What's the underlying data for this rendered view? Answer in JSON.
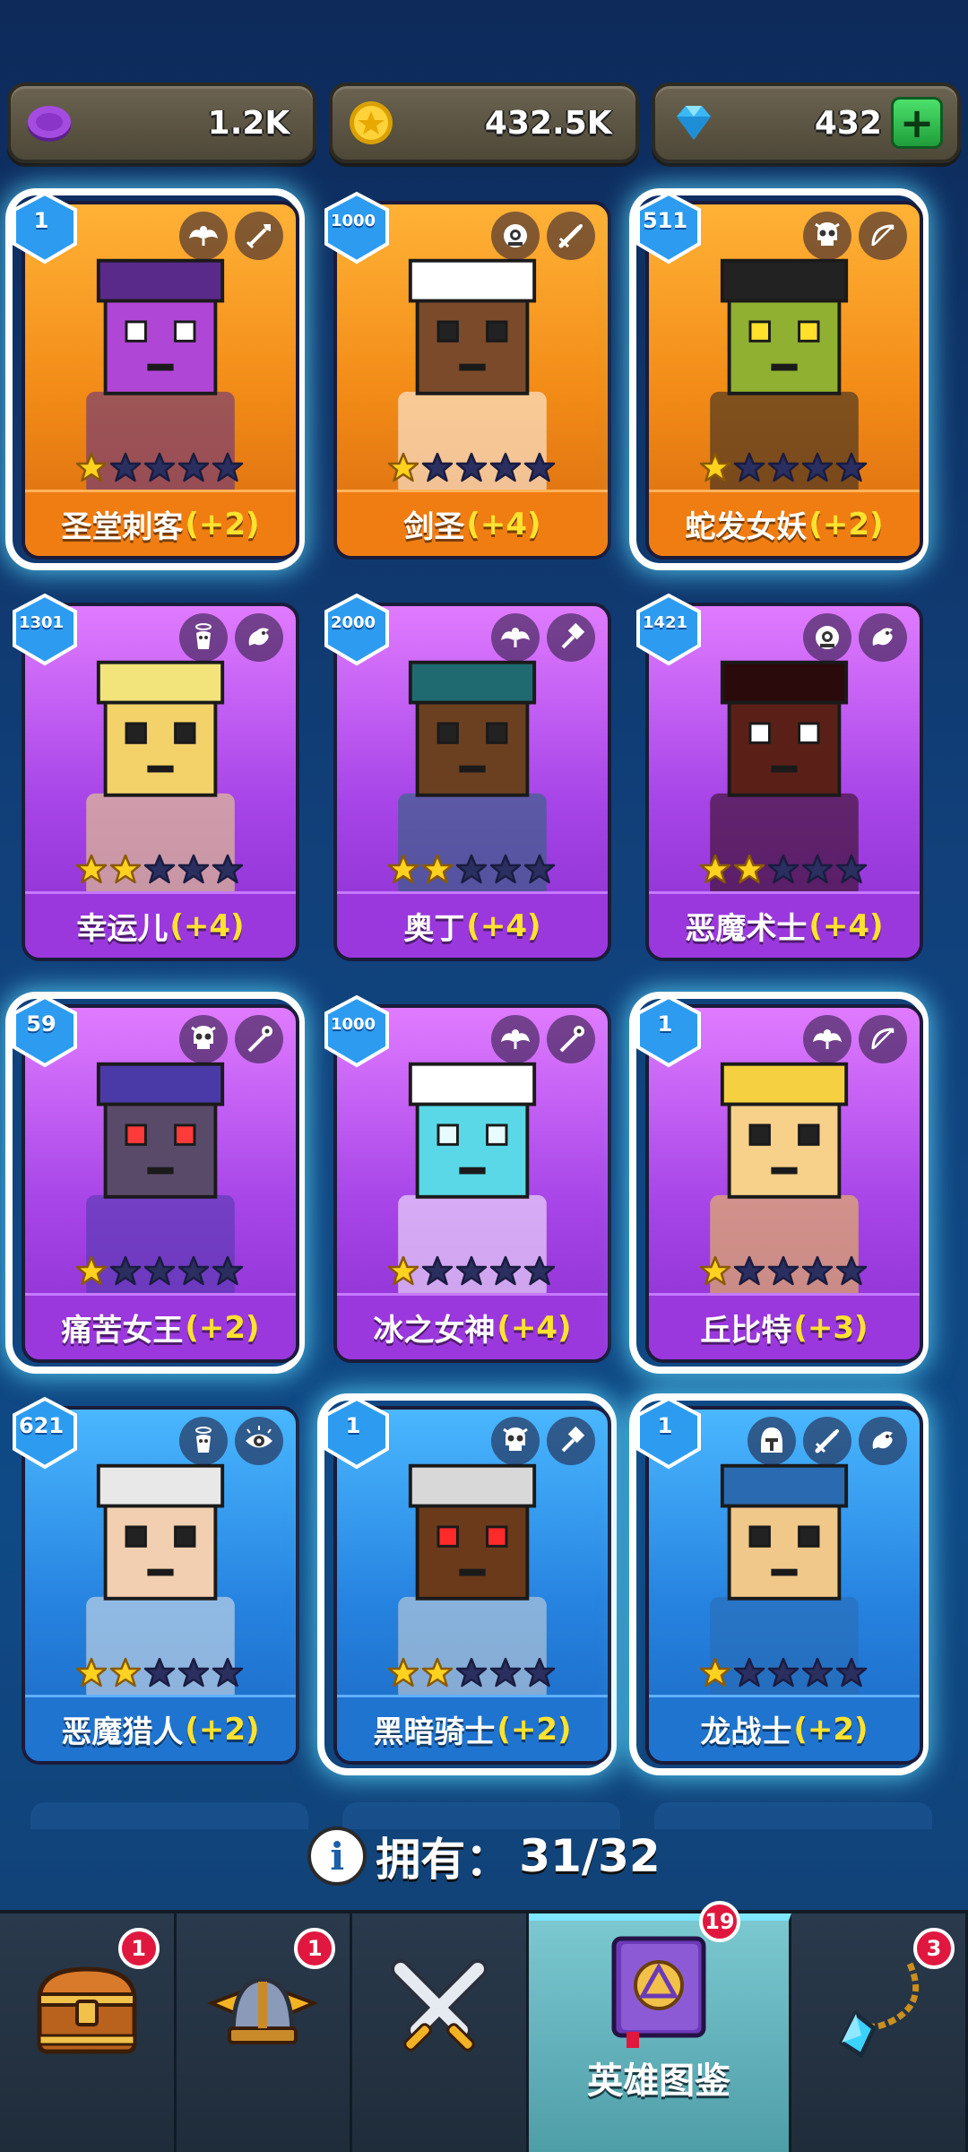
{
  "resources": [
    {
      "name": "purple-coin",
      "value": "1.2K",
      "color": "#9b3fd6"
    },
    {
      "name": "gold-coin",
      "value": "432.5K",
      "color": "#ffcc1a"
    },
    {
      "name": "gem",
      "value": "432",
      "color": "#48c8ff"
    }
  ],
  "heroes": [
    {
      "name": "圣堂刺客",
      "bonus": "(+2)",
      "level": "1",
      "stars": 1,
      "color": "orange",
      "highlighted": true,
      "icons": [
        "winged-emblem-icon",
        "dagger-icon"
      ]
    },
    {
      "name": "剑圣",
      "bonus": "(+4)",
      "level": "1000",
      "stars": 1,
      "color": "orange",
      "highlighted": false,
      "icons": [
        "cyclops-emblem-icon",
        "sword-icon"
      ]
    },
    {
      "name": "蛇发女妖",
      "bonus": "(+2)",
      "level": "511",
      "stars": 1,
      "color": "orange",
      "highlighted": true,
      "icons": [
        "skull-emblem-icon",
        "bow-icon"
      ]
    },
    {
      "name": "幸运儿",
      "bonus": "(+4)",
      "level": "1301",
      "stars": 2,
      "color": "purple",
      "highlighted": false,
      "icons": [
        "angel-emblem-icon",
        "dragon-icon"
      ]
    },
    {
      "name": "奥丁",
      "bonus": "(+4)",
      "level": "2000",
      "stars": 2,
      "color": "purple",
      "highlighted": false,
      "icons": [
        "winged-emblem-icon",
        "hammer-icon"
      ]
    },
    {
      "name": "恶魔术士",
      "bonus": "(+4)",
      "level": "1421",
      "stars": 2,
      "color": "purple",
      "highlighted": false,
      "icons": [
        "cyclops-emblem-icon",
        "dragon-icon"
      ]
    },
    {
      "name": "痛苦女王",
      "bonus": "(+2)",
      "level": "59",
      "stars": 1,
      "color": "purple",
      "highlighted": true,
      "icons": [
        "skull-emblem-icon",
        "staff-icon"
      ]
    },
    {
      "name": "冰之女神",
      "bonus": "(+4)",
      "level": "1000",
      "stars": 1,
      "color": "purple",
      "highlighted": false,
      "icons": [
        "winged-emblem-icon",
        "staff-icon"
      ]
    },
    {
      "name": "丘比特",
      "bonus": "(+3)",
      "level": "1",
      "stars": 1,
      "color": "purple",
      "highlighted": true,
      "icons": [
        "winged-emblem-icon",
        "bow-icon"
      ]
    },
    {
      "name": "恶魔猎人",
      "bonus": "(+2)",
      "level": "621",
      "stars": 2,
      "color": "blue",
      "highlighted": false,
      "icons": [
        "angel-emblem-icon",
        "eye-icon"
      ]
    },
    {
      "name": "黑暗骑士",
      "bonus": "(+2)",
      "level": "1",
      "stars": 2,
      "color": "blue",
      "highlighted": true,
      "icons": [
        "skull-emblem-icon",
        "hammer-icon"
      ]
    },
    {
      "name": "龙战士",
      "bonus": "(+2)",
      "level": "1",
      "stars": 1,
      "color": "blue",
      "highlighted": true,
      "icons": [
        "helmet-emblem-icon",
        "sword-icon",
        "dragon-icon"
      ]
    }
  ],
  "owned": {
    "label": "拥有：",
    "count": "31/32"
  },
  "nav": [
    {
      "name": "chest",
      "label": "",
      "badge": "1",
      "active": false
    },
    {
      "name": "helmet",
      "label": "",
      "badge": "1",
      "active": false
    },
    {
      "name": "battle",
      "label": "",
      "badge": "",
      "active": false
    },
    {
      "name": "hero-codex",
      "label": "英雄图鉴",
      "badge": "19",
      "active": true
    },
    {
      "name": "amulet",
      "label": "",
      "badge": "3",
      "active": false
    }
  ]
}
